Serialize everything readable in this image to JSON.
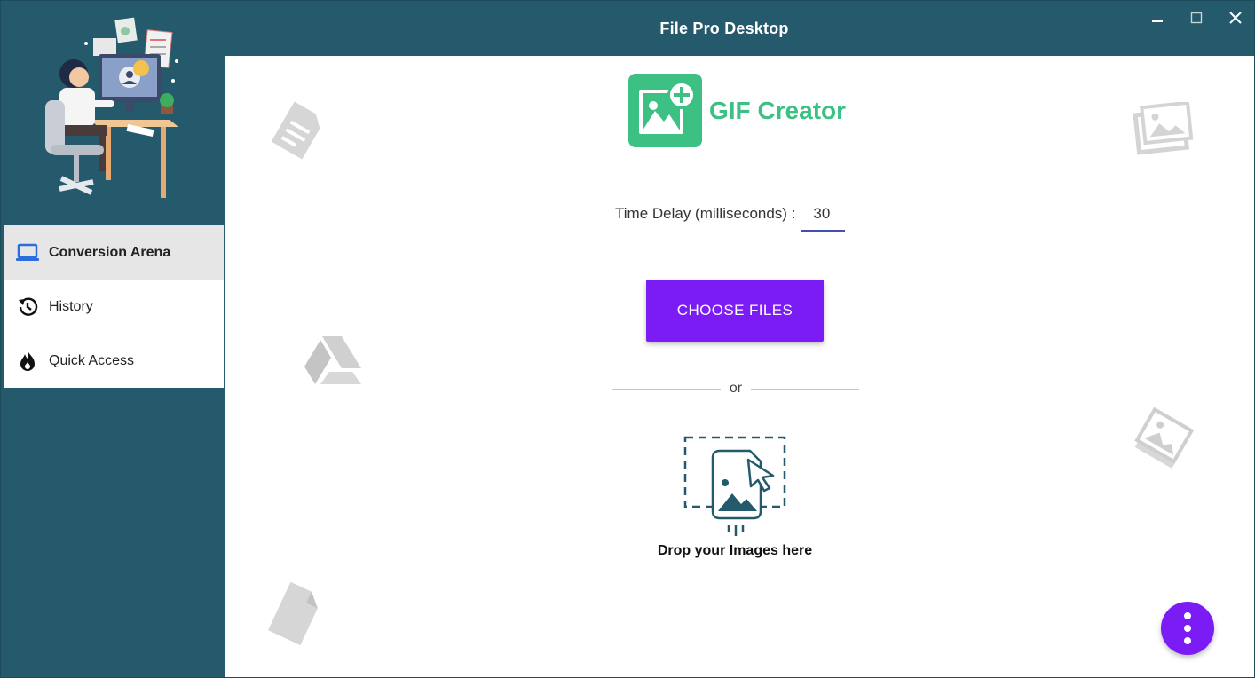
{
  "window": {
    "title": "File Pro Desktop"
  },
  "sidebar": {
    "items": [
      {
        "label": "Conversion Arena",
        "icon": "laptop-icon",
        "active": true
      },
      {
        "label": "History",
        "icon": "history-icon",
        "active": false
      },
      {
        "label": "Quick Access",
        "icon": "fire-icon",
        "active": false
      }
    ]
  },
  "main": {
    "logo_text": "GIF Creator",
    "delay_label": "Time Delay (milliseconds) :",
    "delay_value": "30",
    "choose_button": "CHOOSE FILES",
    "or_text": "or",
    "drop_text": "Drop your Images here"
  },
  "colors": {
    "sidebar": "#245a6b",
    "accent": "#7b1cf5",
    "logo": "#3cc084"
  }
}
